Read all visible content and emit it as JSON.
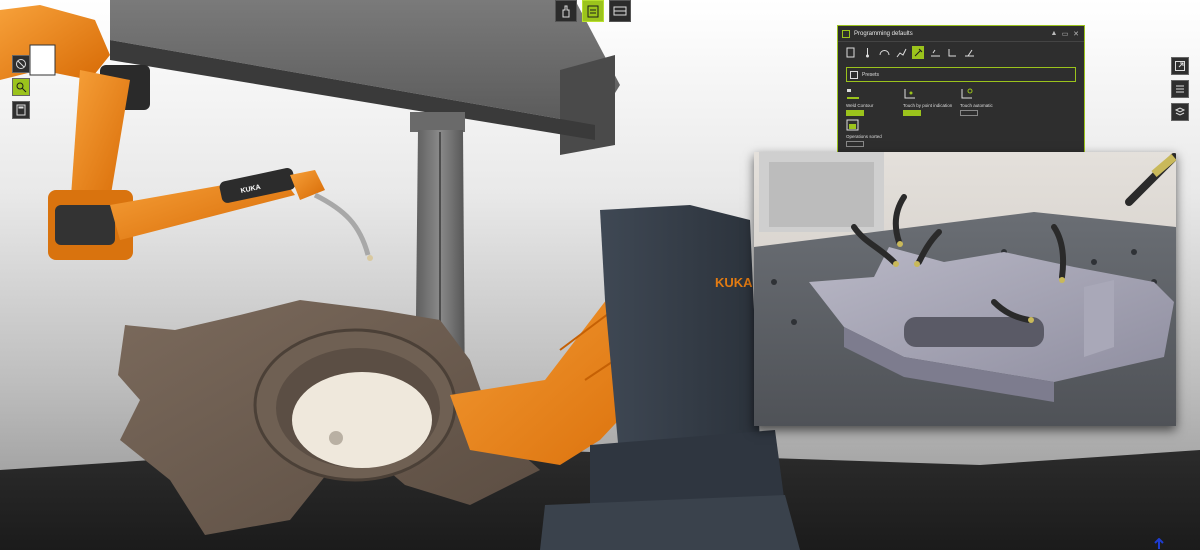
{
  "scene": {
    "brand_mark": "KUKA",
    "robot_arm_badge": "KUKA"
  },
  "top_toolbar": {
    "buttons": [
      {
        "name": "hand-icon",
        "active": false
      },
      {
        "name": "clipboard-program-icon",
        "active": true
      },
      {
        "name": "layout-icon",
        "active": false
      }
    ]
  },
  "left_toolbar": {
    "buttons": [
      {
        "name": "compass-icon",
        "active": false
      },
      {
        "name": "gear-search-icon",
        "active": true
      },
      {
        "name": "calculator-icon",
        "active": false
      }
    ]
  },
  "right_toolbar": {
    "buttons": [
      {
        "name": "export-icon"
      },
      {
        "name": "list-icon"
      },
      {
        "name": "layers-icon"
      }
    ]
  },
  "panel": {
    "title": "Programming defaults",
    "presets_label": "Presets",
    "options": [
      {
        "label": "Weld Contour",
        "on": true
      },
      {
        "label": "Touch by point indication",
        "on": true
      },
      {
        "label": "Touch automatic",
        "on": false
      }
    ],
    "operations_sorted_label": "Operations sorted",
    "operations_sorted_on": false,
    "accent": "#9bc31c"
  }
}
